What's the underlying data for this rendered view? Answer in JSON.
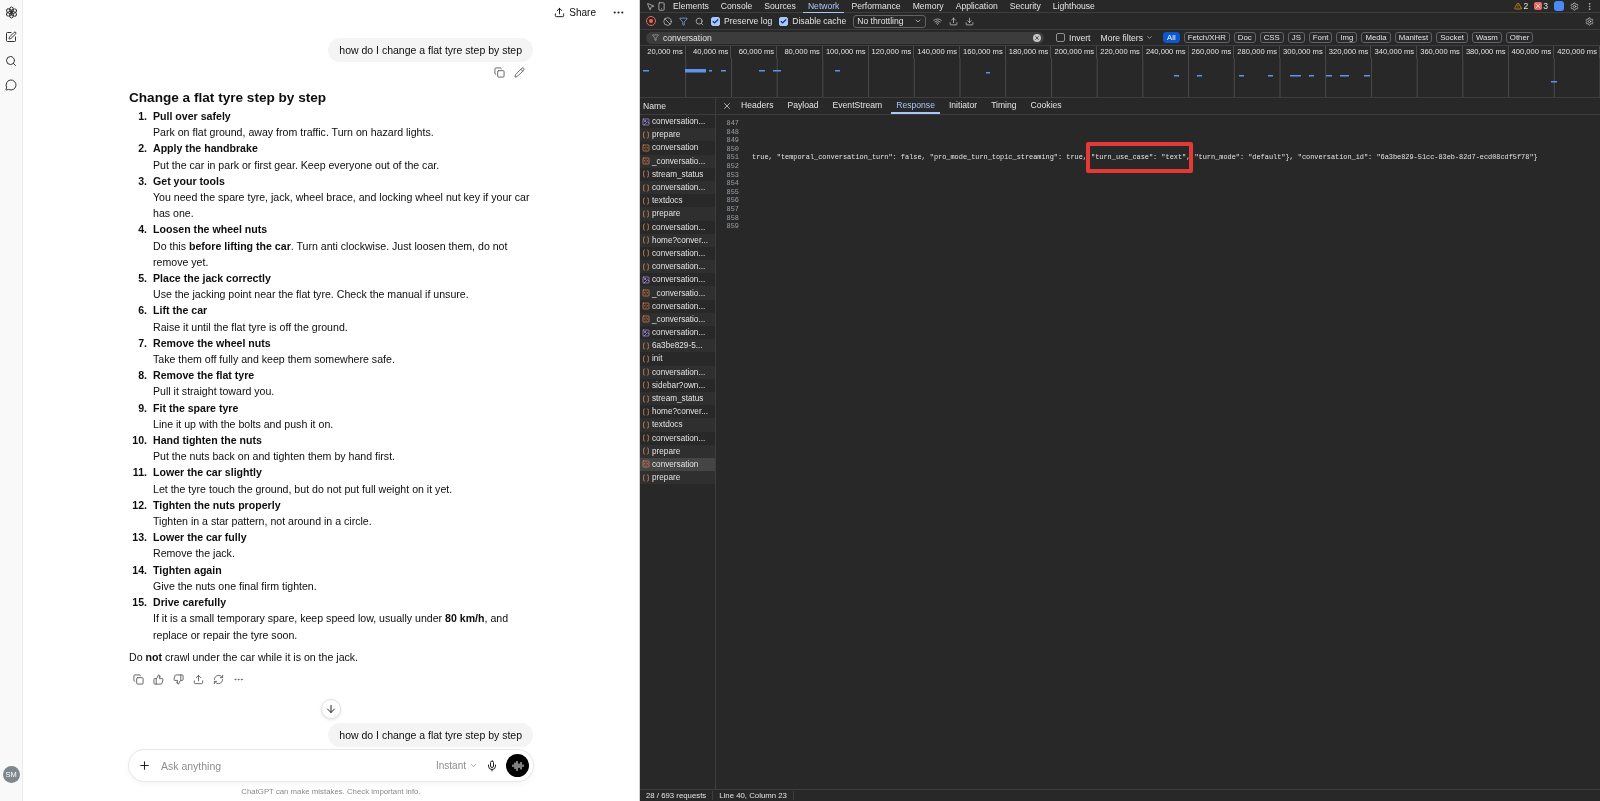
{
  "chat": {
    "share_label": "Share",
    "avatar": "SM",
    "user_message": "how do I change a flat tyre step by step",
    "answer": {
      "title": "Change a flat tyre step by step",
      "steps": [
        {
          "number": "1.",
          "title": "Pull over safely",
          "text": "Park on flat ground, away from traffic. Turn on hazard lights."
        },
        {
          "number": "2.",
          "title": "Apply the handbrake",
          "text": "Put the car in park or first gear. Keep everyone out of the car."
        },
        {
          "number": "3.",
          "title": "Get your tools",
          "text": "You need the spare tyre, jack, wheel brace, and locking wheel nut key if your car has one."
        },
        {
          "number": "4.",
          "title": "Loosen the wheel nuts",
          "text": "Do this **before lifting the car**. Turn anti clockwise. Just loosen them, do not remove yet."
        },
        {
          "number": "5.",
          "title": "Place the jack correctly",
          "text": "Use the jacking point near the flat tyre. Check the manual if unsure."
        },
        {
          "number": "6.",
          "title": "Lift the car",
          "text": "Raise it until the flat tyre is off the ground."
        },
        {
          "number": "7.",
          "title": "Remove the wheel nuts",
          "text": "Take them off fully and keep them somewhere safe."
        },
        {
          "number": "8.",
          "title": "Remove the flat tyre",
          "text": "Pull it straight toward you."
        },
        {
          "number": "9.",
          "title": "Fit the spare tyre",
          "text": "Line it up with the bolts and push it on."
        },
        {
          "number": "10.",
          "title": "Hand tighten the nuts",
          "text": "Put the nuts back on and tighten them by hand first."
        },
        {
          "number": "11.",
          "title": "Lower the car slightly",
          "text": "Let the tyre touch the ground, but do not put full weight on it yet."
        },
        {
          "number": "12.",
          "title": "Tighten the nuts properly",
          "text": "Tighten in a star pattern, not around in a circle."
        },
        {
          "number": "13.",
          "title": "Lower the car fully",
          "text": "Remove the jack."
        },
        {
          "number": "14.",
          "title": "Tighten again",
          "text": "Give the nuts one final firm tighten."
        },
        {
          "number": "15.",
          "title": "Drive carefully",
          "text": "If it is a small temporary spare, keep speed low, usually under **80 km/h**, and replace or repair the tyre soon."
        }
      ],
      "note": "Do **not** crawl under the car while it is on the jack."
    },
    "pending_message": "how do I change a flat tyre step by step",
    "composer": {
      "placeholder": "Ask anything",
      "model": "Instant"
    },
    "disclaimer": "ChatGPT can make mistakes. Check important info."
  },
  "devtools": {
    "panels": [
      {
        "label": "Elements",
        "selected": false
      },
      {
        "label": "Console",
        "selected": false
      },
      {
        "label": "Sources",
        "selected": false
      },
      {
        "label": "Network",
        "selected": true
      },
      {
        "label": "Performance",
        "selected": false
      },
      {
        "label": "Memory",
        "selected": false
      },
      {
        "label": "Application",
        "selected": false
      },
      {
        "label": "Security",
        "selected": false
      },
      {
        "label": "Lighthouse",
        "selected": false
      }
    ],
    "warnings": "2",
    "errors": "3",
    "toolbar": {
      "preserve_log": {
        "label": "Preserve log",
        "checked": true
      },
      "disable_cache": {
        "label": "Disable cache",
        "checked": true
      },
      "throttling": "No throttling"
    },
    "filter": {
      "value": "conversation",
      "invert": {
        "label": "Invert",
        "checked": false
      },
      "more_filters": "More filters",
      "types": [
        {
          "label": "All",
          "selected": true
        },
        {
          "label": "Fetch/XHR",
          "selected": false
        },
        {
          "label": "Doc",
          "selected": false
        },
        {
          "label": "CSS",
          "selected": false
        },
        {
          "label": "JS",
          "selected": false
        },
        {
          "label": "Font",
          "selected": false
        },
        {
          "label": "Img",
          "selected": false
        },
        {
          "label": "Media",
          "selected": false
        },
        {
          "label": "Manifest",
          "selected": false
        },
        {
          "label": "Socket",
          "selected": false
        },
        {
          "label": "Wasm",
          "selected": false
        },
        {
          "label": "Other",
          "selected": false
        }
      ]
    },
    "timeline": {
      "ticks": [
        "20,000 ms",
        "40,000 ms",
        "60,000 ms",
        "80,000 ms",
        "100,000 ms",
        "120,000 ms",
        "140,000 ms",
        "160,000 ms",
        "180,000 ms",
        "200,000 ms",
        "220,000 ms",
        "240,000 ms",
        "260,000 ms",
        "280,000 ms",
        "300,000 ms",
        "320,000 ms",
        "340,000 ms",
        "360,000 ms",
        "380,000 ms",
        "400,000 ms",
        "420,000 ms"
      ]
    },
    "requests": {
      "header": "Name",
      "items": [
        {
          "name": "conversation...",
          "kind": "doc",
          "selected": false
        },
        {
          "name": "prepare",
          "kind": "fetch",
          "selected": false
        },
        {
          "name": "conversation",
          "kind": "stream",
          "selected": false
        },
        {
          "name": "_conversatio...",
          "kind": "stream",
          "selected": false
        },
        {
          "name": "stream_status",
          "kind": "fetch",
          "selected": false
        },
        {
          "name": "conversation...",
          "kind": "fetch",
          "selected": false
        },
        {
          "name": "textdocs",
          "kind": "fetch",
          "selected": false
        },
        {
          "name": "prepare",
          "kind": "fetch",
          "selected": false
        },
        {
          "name": "conversation...",
          "kind": "fetch",
          "selected": false
        },
        {
          "name": "home?conver...",
          "kind": "fetch",
          "selected": false
        },
        {
          "name": "conversation...",
          "kind": "fetch",
          "selected": false
        },
        {
          "name": "conversation...",
          "kind": "fetch",
          "selected": false
        },
        {
          "name": "conversation...",
          "kind": "doc",
          "selected": false
        },
        {
          "name": "_conversatio...",
          "kind": "stream",
          "selected": false
        },
        {
          "name": "conversation...",
          "kind": "stream",
          "selected": false
        },
        {
          "name": "_conversatio...",
          "kind": "stream",
          "selected": false
        },
        {
          "name": "conversation...",
          "kind": "doc",
          "selected": false
        },
        {
          "name": "6a3be829-5...",
          "kind": "fetch",
          "selected": false
        },
        {
          "name": "init",
          "kind": "fetch",
          "selected": false
        },
        {
          "name": "conversation...",
          "kind": "fetch",
          "selected": false
        },
        {
          "name": "sidebar?own...",
          "kind": "fetch",
          "selected": false
        },
        {
          "name": "stream_status",
          "kind": "fetch",
          "selected": false
        },
        {
          "name": "home?conver...",
          "kind": "fetch",
          "selected": false
        },
        {
          "name": "textdocs",
          "kind": "fetch",
          "selected": false
        },
        {
          "name": "conversation...",
          "kind": "fetch",
          "selected": false
        },
        {
          "name": "prepare",
          "kind": "fetch",
          "selected": false
        },
        {
          "name": "conversation",
          "kind": "stream",
          "selected": true
        },
        {
          "name": "prepare",
          "kind": "fetch",
          "selected": false
        }
      ]
    },
    "detail_tabs": [
      {
        "label": "Headers",
        "selected": false
      },
      {
        "label": "Payload",
        "selected": false
      },
      {
        "label": "EventStream",
        "selected": false
      },
      {
        "label": "Response",
        "selected": true
      },
      {
        "label": "Initiator",
        "selected": false
      },
      {
        "label": "Timing",
        "selected": false
      },
      {
        "label": "Cookies",
        "selected": false
      }
    ],
    "response": {
      "lines": [
        {
          "number": "847"
        },
        {
          "number": "848"
        },
        {
          "number": "849"
        },
        {
          "number": "850"
        },
        {
          "number": "851",
          "segments": [
            {
              "text": "true, \"temporal_conversation_turn\": false, \"pro_mode_turn_topic_streaming\": true, ",
              "highlighted": false
            },
            {
              "text": "\"turn_use_case\": \"text\",",
              "highlighted": true
            },
            {
              "text": " \"turn_mode\": \"default\"}, \"conversation_id\": \"6a3be829-51cc-83eb-82d7-ecd08cdf5f78\"}",
              "highlighted": false
            }
          ]
        },
        {
          "number": "852"
        },
        {
          "number": "853"
        },
        {
          "number": "854"
        },
        {
          "number": "855"
        },
        {
          "number": "856"
        },
        {
          "number": "857"
        },
        {
          "number": "858"
        },
        {
          "number": "859"
        }
      ]
    },
    "status": {
      "requests": "28 / 693 requests",
      "cursor": "Line 40, Column 23"
    }
  }
}
